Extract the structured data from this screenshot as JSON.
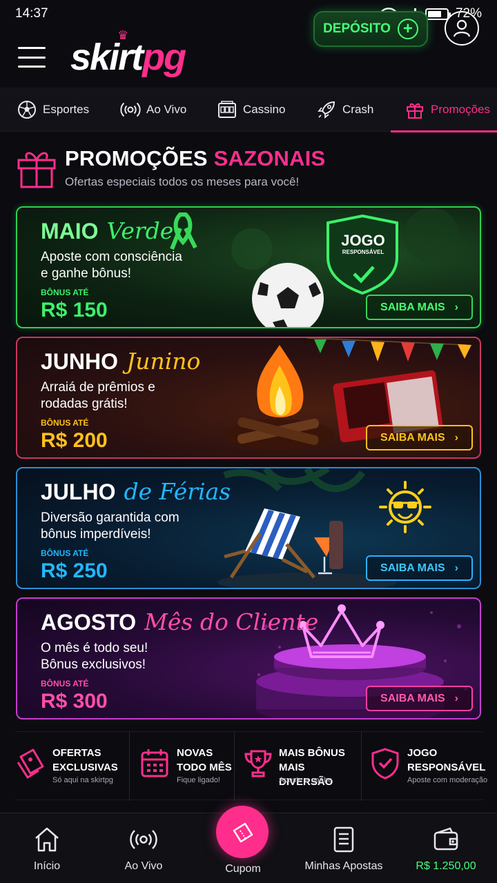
{
  "status_bar": {
    "time": "14:37",
    "battery": "72%",
    "battery_level": 0.72
  },
  "header": {
    "logo_left": "skirt",
    "logo_right": "pg",
    "deposit_label": "DEPÓSITO"
  },
  "tabs": [
    {
      "label": "Esportes",
      "icon": "soccer-ball-icon"
    },
    {
      "label": "Ao Vivo",
      "icon": "live-broadcast-icon"
    },
    {
      "label": "Cassino",
      "icon": "slot-machine-icon"
    },
    {
      "label": "Crash",
      "icon": "rocket-icon"
    },
    {
      "label": "Promoções",
      "icon": "gift-icon",
      "active": true
    }
  ],
  "section": {
    "title_white": "PROMOÇÕES",
    "title_pink": "SAZONAIS",
    "subtitle": "Ofertas especiais todos os meses para você!"
  },
  "promos": [
    {
      "month": "MAIO",
      "theme": "Verde",
      "desc_line1": "Aposte com consciência",
      "desc_line2": "e ganhe bônus!",
      "bonus_label": "BÔNUS ATÉ",
      "bonus_value": "R$ 150",
      "cta": "SAIBA MAIS",
      "badge_line1": "JOGO",
      "badge_line2": "RESPONSÁVEL",
      "accent": "#3cf06a"
    },
    {
      "month": "JUNHO",
      "theme": "Junino",
      "desc_line1": "Arraiá de prêmios e",
      "desc_line2": "rodadas grátis!",
      "bonus_label": "BÔNUS ATÉ",
      "bonus_value": "R$ 200",
      "cta": "SAIBA MAIS",
      "accent": "#ffc21a"
    },
    {
      "month": "JULHO",
      "theme": "de Férias",
      "desc_line1": "Diversão garantida com",
      "desc_line2": "bônus imperdíveis!",
      "bonus_label": "BÔNUS ATÉ",
      "bonus_value": "R$ 250",
      "cta": "SAIBA MAIS",
      "accent": "#23b6ff"
    },
    {
      "month": "AGOSTO",
      "theme": "Mês do Cliente",
      "desc_line1": "O mês é todo seu!",
      "desc_line2": "Bônus exclusivos!",
      "bonus_label": "BÔNUS ATÉ",
      "bonus_value": "R$ 300",
      "cta": "SAIBA MAIS",
      "accent": "#ff4fa8"
    }
  ],
  "features": [
    {
      "title1": "OFERTAS",
      "title2": "EXCLUSIVAS",
      "sub": "Só aqui na skirtpg",
      "icon": "ticket-icon"
    },
    {
      "title1": "NOVAS",
      "title2": "TODO MÊS",
      "sub": "Fique ligado!",
      "icon": "calendar-icon"
    },
    {
      "title1": "MAIS BÔNUS",
      "title2": "MAIS DIVERSÃO",
      "sub": "Aposte e ganhe",
      "icon": "trophy-icon"
    },
    {
      "title1": "JOGO",
      "title2": "RESPONSÁVEL",
      "sub": "Aposte com moderação",
      "icon": "shield-check-icon"
    }
  ],
  "bottom_nav": [
    {
      "label": "Início",
      "icon": "home-icon"
    },
    {
      "label": "Ao Vivo",
      "icon": "live-broadcast-icon"
    },
    {
      "label": "Cupom",
      "icon": "coupon-icon"
    },
    {
      "label": "Minhas Apostas",
      "icon": "document-icon"
    },
    {
      "label": "R$ 1.250,00",
      "icon": "wallet-icon"
    }
  ]
}
